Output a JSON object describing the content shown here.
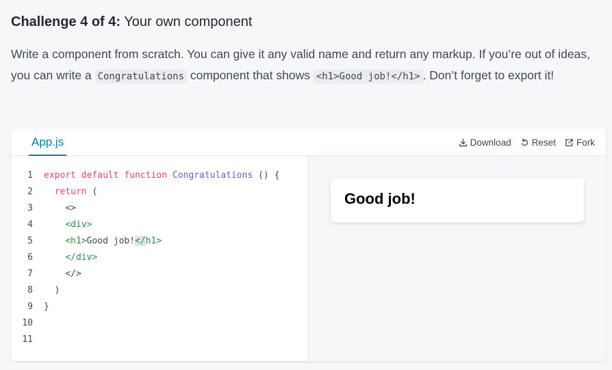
{
  "challenge": {
    "counter": "Challenge 4 of 4:",
    "title": "Your own component",
    "desc_part1": "Write a component from scratch. You can give it any valid name and return any markup. If you’re out of ideas, you can write a ",
    "desc_code1": "Congratulations",
    "desc_part2": " component that shows ",
    "desc_code2": "<h1>Good job!</h1>",
    "desc_part3": ". Don’t forget to export it!"
  },
  "sandbox": {
    "tab_label": "App.js",
    "actions": {
      "download": "Download",
      "reset": "Reset",
      "fork": "Fork"
    },
    "line_numbers": [
      "1",
      "2",
      "3",
      "4",
      "5",
      "6",
      "7",
      "8",
      "9",
      "10",
      "11"
    ],
    "code": {
      "l1_kw1": "export",
      "l1_kw2": "default",
      "l1_kw3": "function",
      "l1_name": "Congratulations",
      "l1_rest": " () {",
      "l2_indent": "  ",
      "l2_kw": "return",
      "l2_rest": " (",
      "l3_indent": "    ",
      "l3": "<>",
      "l4_indent": "    ",
      "l4": "<div>",
      "l5_indent": "    ",
      "l5_open": "<h1>",
      "l5_text": "Good job!",
      "l5_close_lt": "</",
      "l5_close_rest": "h1>",
      "l6_indent": "    ",
      "l6": "</div>",
      "l7_indent": "    ",
      "l7": "</>",
      "l8_indent": "  ",
      "l8": ")",
      "l9": "}",
      "l10": "",
      "l11": ""
    },
    "preview_heading": "Good job!"
  },
  "colors": {
    "accent": "#087ea4",
    "keyword": "#d9476b",
    "function_name": "#6b5cbd",
    "tag": "#2d8a46"
  },
  "icons": {
    "download": "download-icon",
    "reset": "reset-icon",
    "fork": "fork-icon"
  }
}
